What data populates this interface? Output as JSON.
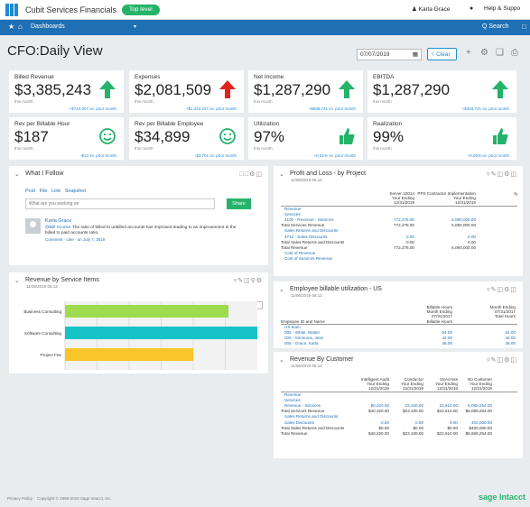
{
  "header": {
    "company": "Cubit Services Financials",
    "top_level": "Top level",
    "user": "Karla Grace",
    "help": "Help & Suppo"
  },
  "nav": {
    "dashboards": "Dashboards",
    "search": "Q Search"
  },
  "page": {
    "title": "CFO:Daily View",
    "date": "07/07/2019",
    "clear": "Clear"
  },
  "kpis": [
    {
      "label": "Billed Revenue",
      "value": "$3,385,243",
      "sub": "this month",
      "compare": "+$744,207 vs. prior month",
      "trend": "up"
    },
    {
      "label": "Expenses",
      "value": "$2,081,509",
      "sub": "this month",
      "compare": "+$1,343,227 vs. prior month",
      "trend": "up-red"
    },
    {
      "label": "Net Income",
      "value": "$1,287,290",
      "sub": "this month",
      "compare": "+$598,721 vs. prior month",
      "trend": "up"
    },
    {
      "label": "EBITDA",
      "value": "$1,287,290",
      "sub": "this month",
      "compare": "+$393,721 vs. prior month",
      "trend": "up"
    },
    {
      "label": "Rev per Billable Hour",
      "value": "$187",
      "sub": "this month",
      "compare": "-$13 vs. prior month",
      "trend": "smile"
    },
    {
      "label": "Rev per Billable Employee",
      "value": "$34,899",
      "sub": "this month",
      "compare": "-$3,701 vs. prior month",
      "trend": "smile"
    },
    {
      "label": "Utilization",
      "value": "97%",
      "sub": "this month",
      "compare": "+0.41% vs. prior month",
      "trend": "thumb"
    },
    {
      "label": "Realization",
      "value": "99%",
      "sub": "this month",
      "compare": "+0.06% vs. prior month",
      "trend": "thumb"
    }
  ],
  "follow": {
    "title": "What I Follow",
    "post": "Post",
    "file": "File",
    "link": "Link",
    "snapshot": "Snapshot",
    "placeholder": "What are you working on",
    "share": "Share",
    "author": "Karla Grace",
    "mention": "@Bill Sconce",
    "message": "The ratio of billed to unbilled accounts has improved leading to an improvement in the billed to paid accounts ratio.",
    "meta": "Comment · Like · on July 7, 2019"
  },
  "pl": {
    "title": "Profit and Loss - by Project",
    "date": "11/06/2019 06:12",
    "cols": [
      "Server 10014\nYour Ending\n12/31/2019",
      "PPS Contractor Implementation\nYour Ending\n12/31/2019",
      "system docu\nYo"
    ],
    "rows": [
      {
        "name": "Revenue",
        "v": [
          "",
          "",
          ""
        ],
        "cls": "blue"
      },
      {
        "name": "Services",
        "v": [
          "",
          "",
          ""
        ],
        "cls": "blue"
      },
      {
        "name": "4100 - Revenue - Services",
        "v": [
          "772,278.00",
          "5,090,000.00",
          ""
        ],
        "cls": "blue"
      },
      {
        "name": "Total Services Revenue",
        "v": [
          "772,278.00",
          "5,090,000.00",
          ""
        ],
        "cls": ""
      },
      {
        "name": "Sales Returns and Discounts",
        "v": [
          "",
          "",
          ""
        ],
        "cls": "blue"
      },
      {
        "name": "4710 - Sales Discounts",
        "v": [
          "0.00",
          "0.00",
          ""
        ],
        "cls": "blue"
      },
      {
        "name": "Total Sales Returns and Discounts",
        "v": [
          "0.00",
          "0.00",
          ""
        ],
        "cls": ""
      },
      {
        "name": "Total Revenue",
        "v": [
          "772,278.00",
          "5,090,000.00",
          ""
        ],
        "cls": ""
      },
      {
        "name": "Cost of Revenue",
        "v": [
          "",
          "",
          ""
        ],
        "cls": "blue"
      },
      {
        "name": "Cost of Services Revenue",
        "v": [
          "",
          "",
          ""
        ],
        "cls": "blue"
      }
    ]
  },
  "rev": {
    "title": "Revenue by Service Items",
    "date": "11/25/2019 06:12"
  },
  "chart_data": {
    "type": "bar",
    "orientation": "horizontal",
    "categories": [
      "Business Consulting",
      "Software Consulting",
      "Project Fee"
    ],
    "values": [
      255000,
      300000,
      200000
    ],
    "colors": [
      "#9edb4e",
      "#17c3c7",
      "#f8c52b"
    ],
    "ticks": [
      "$0",
      "$50,000",
      "$100,000",
      "$150,000",
      "$200,000",
      "$250,000"
    ],
    "xlim": [
      0,
      300000
    ],
    "title": "Revenue by Service Items"
  },
  "util": {
    "title": "Employee billable utilization - US",
    "date": "11/06/2019 06:12",
    "cols": [
      "Billable Hours\nMonth Ending\n07/31/2017\nBillable Hours",
      "Month Ending\n07/31/2017\nTotal Hours"
    ],
    "header": "Employee ID and Name",
    "rows": [
      {
        "name": "US team",
        "v": [
          "",
          ""
        ],
        "cls": "blue"
      },
      {
        "name": "005 - White, Walter",
        "v": [
          "54.00",
          "54.00"
        ],
        "cls": "blue"
      },
      {
        "name": "006 - Simmons, Jean",
        "v": [
          "42.00",
          "42.00"
        ],
        "cls": "blue"
      },
      {
        "name": "008 - Grace, Karla",
        "v": [
          "48.00",
          "48.00"
        ],
        "cls": "blue"
      },
      {
        "name": "Total US team",
        "v": [
          "144.00",
          "144.00"
        ],
        "cls": ""
      }
    ]
  },
  "cust": {
    "title": "Revenue By Customer",
    "date": "11/06/2019 06:12",
    "cols": [
      "Intelligent Audit\nYour Ending\n12/31/2019",
      "Conductor\nYour Ending\n12/31/2019",
      "SSAcross\nYour Ending\n12/31/2019",
      "No Customer\nYour Ending\n12/31/2019",
      "All C\nYo\n12/3"
    ],
    "rows": [
      {
        "name": "Revenue",
        "v": [
          "",
          "",
          "",
          "",
          ""
        ],
        "cls": "blue"
      },
      {
        "name": "Services",
        "v": [
          "",
          "",
          "",
          "",
          ""
        ],
        "cls": "blue"
      },
      {
        "name": "Revenue - Services",
        "v": [
          "$0,320.00",
          "23,100.00",
          "22,610.00",
          "6,089,254.00",
          "6,0"
        ],
        "cls": "blue"
      },
      {
        "name": "Total Services Revenue",
        "v": [
          "$40,320.00",
          "$23,100.00",
          "$22,610.00",
          "$6,089,254.00",
          "$6,0"
        ],
        "cls": ""
      },
      {
        "name": "Sales Returns and Discounts",
        "v": [
          "",
          "",
          "",
          "",
          ""
        ],
        "cls": "blue"
      },
      {
        "name": "Sales Discounts",
        "v": [
          "0.00",
          "0.00",
          "0.00",
          "400,000.00",
          "4"
        ],
        "cls": "blue"
      },
      {
        "name": "Total Sales Returns and Discounts",
        "v": [
          "$0.00",
          "$0.00",
          "$0.00",
          "$400,000.00",
          "$4"
        ],
        "cls": ""
      },
      {
        "name": "Total Revenue",
        "v": [
          "$40,320.00",
          "$23,100.00",
          "$22,610.00",
          "$5,689,254.00",
          "$5,6"
        ],
        "cls": ""
      }
    ]
  },
  "footer": {
    "privacy": "Privacy Policy",
    "copyright": "Copyright © 1999-2019 Sage Intacct, Inc.",
    "brand": "sage Intacct"
  }
}
